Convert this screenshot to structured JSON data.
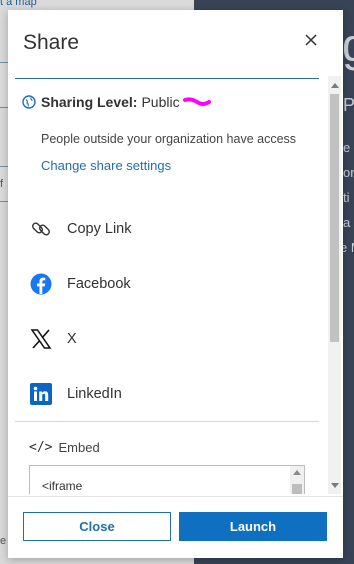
{
  "background": {
    "top_link": "t a map",
    "fragments": [
      "P",
      "e",
      "or",
      "ti",
      "a",
      "e M",
      "e",
      "f",
      "g"
    ]
  },
  "dialog": {
    "title": "Share",
    "close_icon": "close-icon"
  },
  "sharing": {
    "label": "Sharing Level:",
    "value": "Public",
    "description": "People outside your organization have access",
    "change_link": "Change share settings",
    "icon": "globe-icon"
  },
  "share_options": [
    {
      "label": "Copy Link",
      "icon": "link-icon"
    },
    {
      "label": "Facebook",
      "icon": "facebook-icon"
    },
    {
      "label": "X",
      "icon": "x-logo-icon"
    },
    {
      "label": "LinkedIn",
      "icon": "linkedin-icon"
    }
  ],
  "embed": {
    "icon_text": "</>",
    "label": "Embed",
    "code_line1": "<iframe"
  },
  "footer": {
    "close_label": "Close",
    "launch_label": "Launch"
  },
  "colors": {
    "accent": "#0f6fc1",
    "facebook": "#1877f2",
    "linkedin": "#0a66c2",
    "highlight_scribble": "#ff00ff"
  }
}
